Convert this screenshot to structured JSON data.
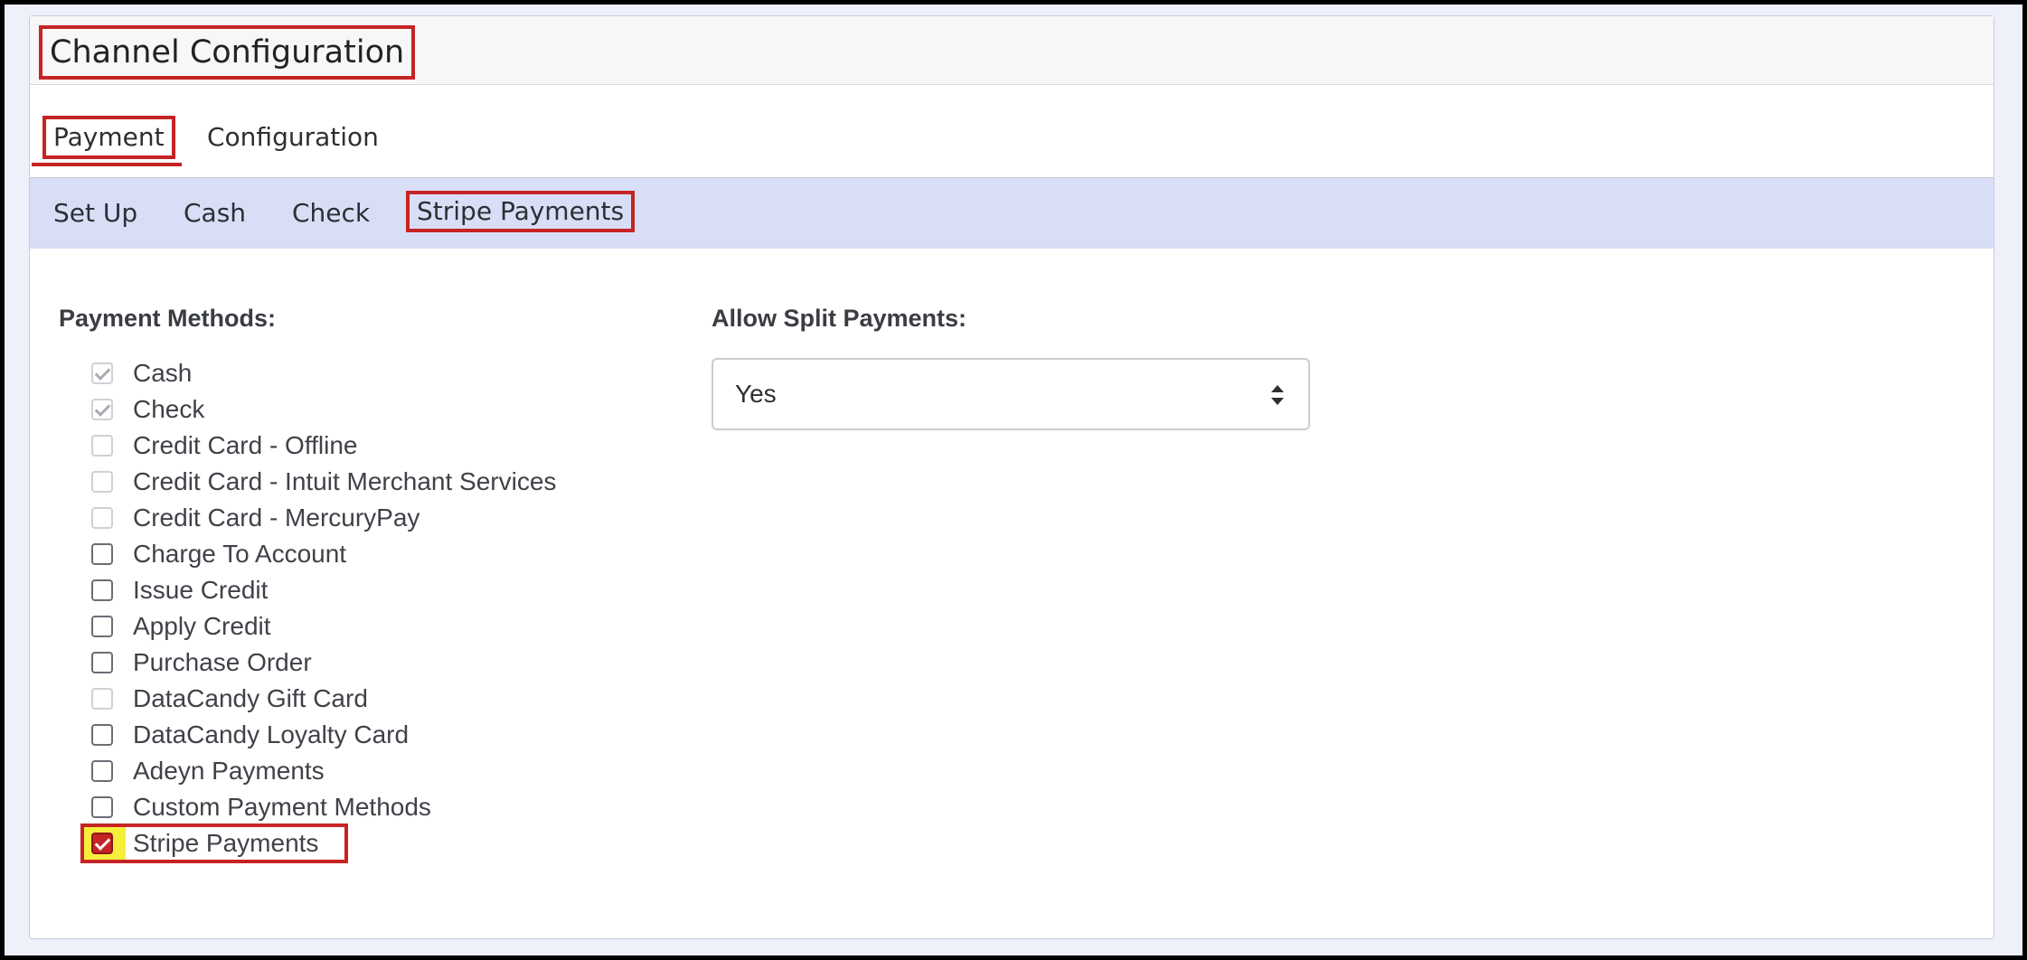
{
  "header": {
    "title": "Channel Configuration"
  },
  "tabs": [
    {
      "label": "Payment",
      "active": true
    },
    {
      "label": "Configuration",
      "active": false
    }
  ],
  "subtabs": [
    {
      "label": "Set Up"
    },
    {
      "label": "Cash"
    },
    {
      "label": "Check"
    },
    {
      "label": "Stripe Payments",
      "highlighted": true
    }
  ],
  "payment_methods": {
    "label": "Payment Methods:",
    "items": [
      {
        "label": "Cash",
        "checked": true,
        "disabled": true
      },
      {
        "label": "Check",
        "checked": true,
        "disabled": true
      },
      {
        "label": "Credit Card - Offline",
        "checked": false,
        "disabled": true
      },
      {
        "label": "Credit Card - Intuit Merchant Services",
        "checked": false,
        "disabled": true
      },
      {
        "label": "Credit Card - MercuryPay",
        "checked": false,
        "disabled": true
      },
      {
        "label": "Charge To Account",
        "checked": false,
        "disabled": false
      },
      {
        "label": "Issue Credit",
        "checked": false,
        "disabled": false
      },
      {
        "label": "Apply Credit",
        "checked": false,
        "disabled": false
      },
      {
        "label": "Purchase Order",
        "checked": false,
        "disabled": false
      },
      {
        "label": "DataCandy Gift Card",
        "checked": false,
        "disabled": true
      },
      {
        "label": "DataCandy Loyalty Card",
        "checked": false,
        "disabled": false
      },
      {
        "label": "Adeyn Payments",
        "checked": false,
        "disabled": false
      },
      {
        "label": "Custom Payment Methods",
        "checked": false,
        "disabled": false
      },
      {
        "label": "Stripe Payments",
        "checked": true,
        "disabled": false
      }
    ]
  },
  "split_payments": {
    "label": "Allow Split Payments:",
    "value": "Yes"
  },
  "colors": {
    "highlight": "#c62424",
    "subnav_bg": "#d9def7",
    "checkbox_highlight": "#f5ef3c"
  }
}
